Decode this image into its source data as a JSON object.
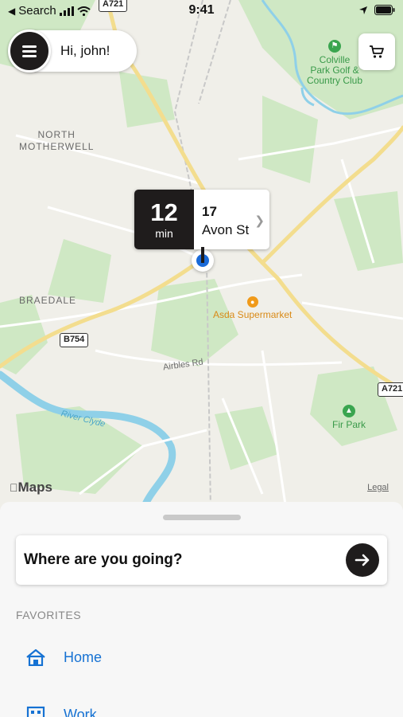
{
  "status_bar": {
    "back_label": "Search",
    "time": "9:41"
  },
  "header": {
    "greeting": "Hi, john!"
  },
  "map": {
    "labels": {
      "north_motherwell": [
        "NORTH",
        "MOTHERWELL"
      ],
      "braedale": "BRAEDALE",
      "airbles_rd": "Airbles Rd",
      "river_clyde": "River Clyde",
      "asda": "Asda Supermarket",
      "fir_park": "Fir Park",
      "colville": [
        "Colville",
        "Park Golf &",
        "Country Club"
      ]
    },
    "road_shields": {
      "a721_top": "A721",
      "b754": "B754",
      "a721_right": "A721"
    },
    "attribution": "Maps",
    "legal": "Legal"
  },
  "pickup": {
    "eta_value": "12",
    "eta_unit": "min",
    "street_number": "17",
    "street_name": "Avon St"
  },
  "sheet": {
    "search_prompt": "Where are you going?",
    "favorites_heading": "FAVORITES",
    "favorites": [
      {
        "label": "Home",
        "icon": "home-icon"
      },
      {
        "label": "Work",
        "icon": "work-icon"
      }
    ]
  },
  "colors": {
    "dark": "#1f1c1c",
    "accent_blue": "#1672d3",
    "pin_blue": "#1a6ad8",
    "map_green": "#cfe8c4",
    "water": "#8fd0e8",
    "road_yellow": "#f3dd8e"
  }
}
